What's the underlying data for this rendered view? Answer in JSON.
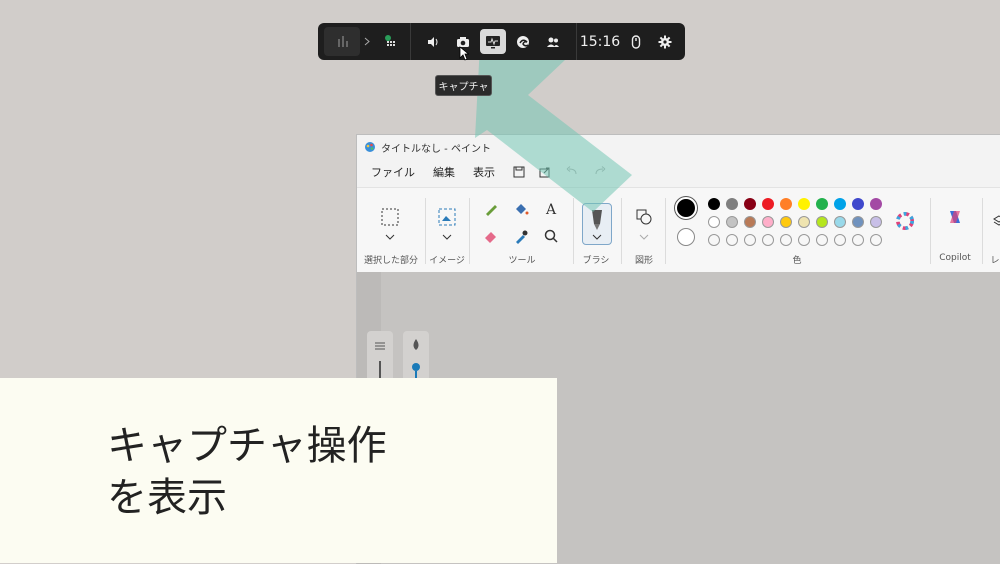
{
  "gamebar": {
    "clock": "15:16",
    "tooltip": "キャプチャ",
    "widgets": [
      "performance-icon",
      "chevron-right-icon",
      "widget-menu-icon",
      "audio-icon",
      "capture-icon",
      "performance-monitor-icon",
      "edge-icon",
      "social-icon",
      "mouse-icon",
      "settings-icon"
    ]
  },
  "paint": {
    "title": "タイトルなし - ペイント",
    "menu": [
      "ファイル",
      "編集",
      "表示"
    ],
    "groups": {
      "selection": "選択した部分",
      "image": "イメージ",
      "tools": "ツール",
      "brush": "ブラシ",
      "shapes": "図形",
      "colors": "色",
      "copilot": "Copilot",
      "layers": "レ"
    },
    "palette_row1": [
      "#000000",
      "#7f7f7f",
      "#880015",
      "#ed1c24",
      "#ff7f27",
      "#fff200",
      "#22b14c",
      "#00a2e8",
      "#3f48cc",
      "#a349a4"
    ],
    "palette_row2": [
      "#ffffff",
      "#c3c3c3",
      "#b97a57",
      "#ffaec9",
      "#ffc90e",
      "#efe4b0",
      "#b5e61d",
      "#99d9ea",
      "#7092be",
      "#c8bfe7"
    ],
    "primary_color": "#000000",
    "secondary_color": "#ffffff"
  },
  "caption": {
    "text": "キャプチャ操作\nを表示"
  },
  "accent": "#74c7b4"
}
